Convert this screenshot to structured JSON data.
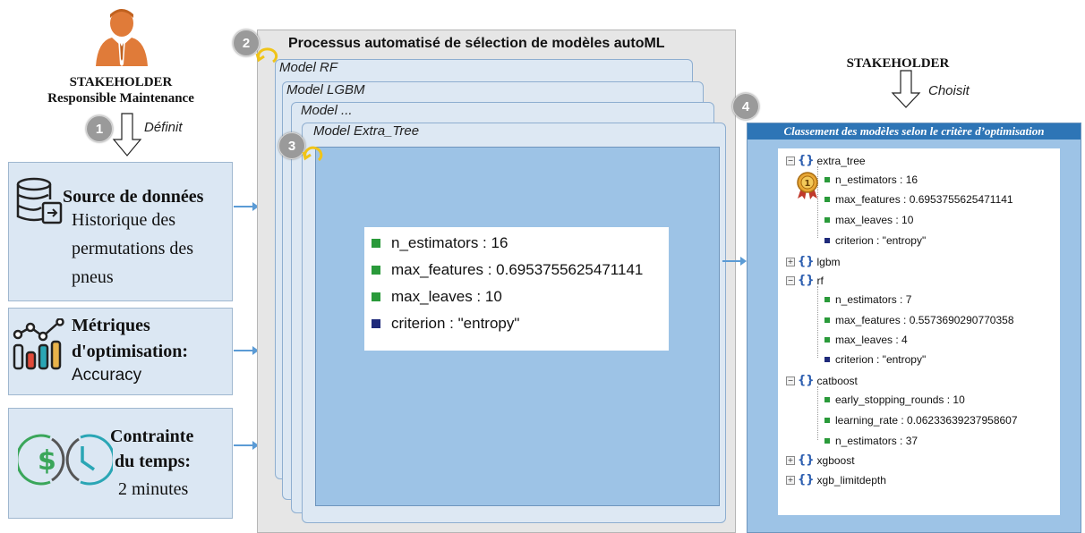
{
  "colors": {
    "accent": "#5b9bd5",
    "panel_header": "#2e75b6",
    "green_square": "#2a9a3a",
    "navy_square": "#1f2a7a",
    "step_gray": "#9a9a9a"
  },
  "left": {
    "stakeholder_line1": "STAKEHOLDER",
    "stakeholder_line2": "Responsible Maintenance",
    "step1": "1",
    "defines": "Définit",
    "data_source": {
      "title": "Source de données",
      "line1": "Historique des",
      "line2": "permutations des",
      "line3": "pneus"
    },
    "metrics": {
      "line1": "Métriques",
      "line2": "d'optimisation:",
      "line3": "Accuracy"
    },
    "time": {
      "line1": "Contrainte",
      "line2": "du temps:",
      "line3": "2 minutes"
    }
  },
  "middle": {
    "step2": "2",
    "title": "Processus automatisé de sélection de modèles autoML",
    "models": [
      "Model RF",
      "Model LGBM",
      "Model ...",
      "Model Extra_Tree"
    ],
    "step3": "3",
    "params": [
      {
        "text": "n_estimators : 16",
        "color": "#2a9a3a"
      },
      {
        "text": "max_features : 0.6953755625471141",
        "color": "#2a9a3a"
      },
      {
        "text": "max_leaves : 10",
        "color": "#2a9a3a"
      },
      {
        "text": "criterion : \"entropy\"",
        "color": "#1f2a7a"
      }
    ]
  },
  "right": {
    "stakeholder": "STAKEHOLDER",
    "chooses": "Choisit",
    "step4": "4",
    "header": "Classement des modèles selon le critère d’optimisation",
    "tree": {
      "extra_tree": "extra_tree",
      "extra_tree_children": [
        "n_estimators : 16",
        "max_features : 0.6953755625471141",
        "max_leaves : 10",
        "criterion : \"entropy\""
      ],
      "lgbm": "lgbm",
      "rf": "rf",
      "rf_children": [
        "n_estimators : 7",
        "max_features : 0.5573690290770358",
        "max_leaves : 4",
        "criterion : \"entropy\""
      ],
      "catboost": "catboost",
      "catboost_children": [
        "early_stopping_rounds : 10",
        "learning_rate : 0.06233639237958607",
        "n_estimators : 37"
      ],
      "xgboost": "xgboost",
      "xgb_limitdepth": "xgb_limitdepth",
      "medal": "1"
    }
  }
}
